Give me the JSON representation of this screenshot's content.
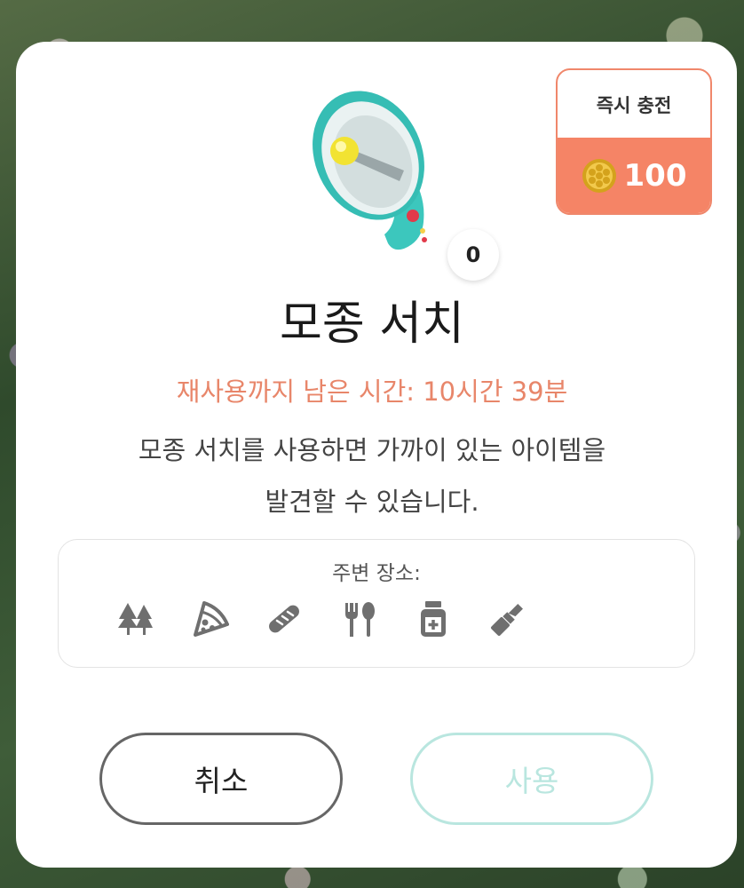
{
  "dialog": {
    "title": "모종 서치",
    "cooldown": "재사용까지 남은 시간: 10시간 39분",
    "description_line1": "모종 서치를 사용하면 가까이 있는 아이템을",
    "description_line2": "발견할 수 있습니다.",
    "item_count": "0"
  },
  "instant_charge": {
    "label": "즉시 충전",
    "price": "100",
    "currency_icon": "gold-coin-icon"
  },
  "nearby_places": {
    "label": "주변 장소:",
    "icons": [
      "forest-icon",
      "pizza-icon",
      "bread-icon",
      "restaurant-icon",
      "pharmacy-icon",
      "cosmetics-icon"
    ]
  },
  "buttons": {
    "cancel_label": "취소",
    "use_label": "사용"
  },
  "colors": {
    "accent_orange": "#f58466",
    "cooldown_text": "#e8866a",
    "use_button_disabled": "#b9e6df"
  }
}
